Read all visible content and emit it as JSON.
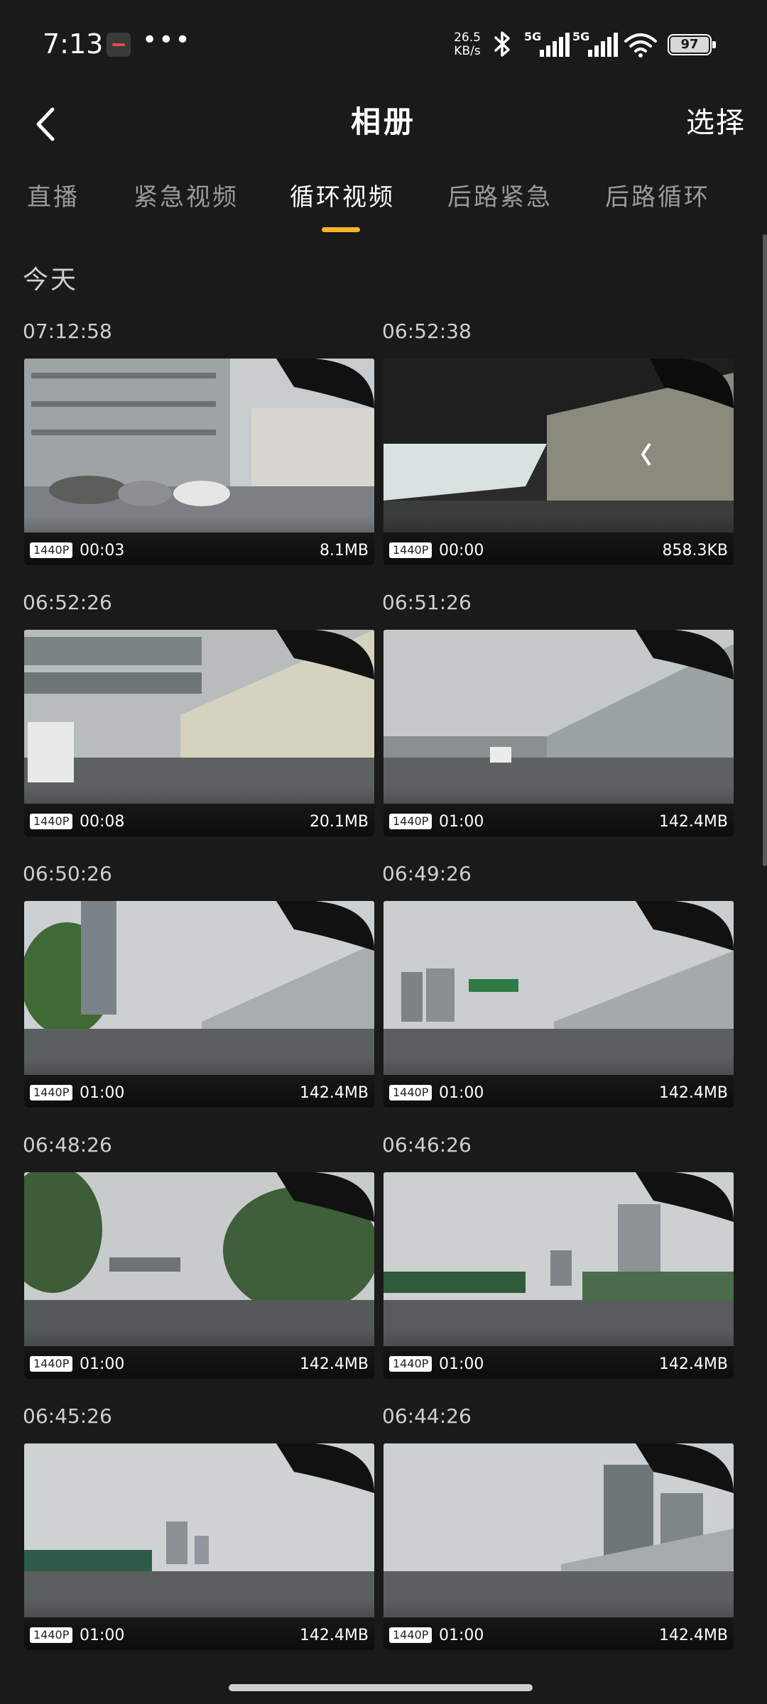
{
  "status_bar": {
    "time": "7:13",
    "overflow": "•••",
    "net_speed_value": "26.5",
    "net_speed_unit": "KB/s",
    "network_1": "5G",
    "network_2": "5G",
    "battery": "97",
    "icons": [
      "app-notification-icon",
      "bluetooth-icon",
      "signal-icon",
      "signal-icon",
      "wifi-icon",
      "battery-icon"
    ]
  },
  "header": {
    "title": "相册",
    "action": "选择",
    "back_icon": "chevron-left-icon"
  },
  "tabs": [
    {
      "label": "直播"
    },
    {
      "label": "紧急视频"
    },
    {
      "label": "循环视频",
      "active": true
    },
    {
      "label": "后路紧急"
    },
    {
      "label": "后路循环"
    }
  ],
  "colors": {
    "background": "#1a1a1a",
    "accent": "#f5b62a"
  },
  "section": {
    "title": "今天"
  },
  "videos": [
    {
      "time": "07:12:58",
      "resolution": "1440P",
      "duration": "00:03",
      "size": "8.1MB"
    },
    {
      "time": "06:52:38",
      "resolution": "1440P",
      "duration": "00:00",
      "size": "858.3KB"
    },
    {
      "time": "06:52:26",
      "resolution": "1440P",
      "duration": "00:08",
      "size": "20.1MB"
    },
    {
      "time": "06:51:26",
      "resolution": "1440P",
      "duration": "01:00",
      "size": "142.4MB"
    },
    {
      "time": "06:50:26",
      "resolution": "1440P",
      "duration": "01:00",
      "size": "142.4MB"
    },
    {
      "time": "06:49:26",
      "resolution": "1440P",
      "duration": "01:00",
      "size": "142.4MB"
    },
    {
      "time": "06:48:26",
      "resolution": "1440P",
      "duration": "01:00",
      "size": "142.4MB"
    },
    {
      "time": "06:46:26",
      "resolution": "1440P",
      "duration": "01:00",
      "size": "142.4MB"
    },
    {
      "time": "06:45:26",
      "resolution": "1440P",
      "duration": "01:00",
      "size": "142.4MB"
    },
    {
      "time": "06:44:26",
      "resolution": "1440P",
      "duration": "01:00",
      "size": "142.4MB"
    }
  ]
}
